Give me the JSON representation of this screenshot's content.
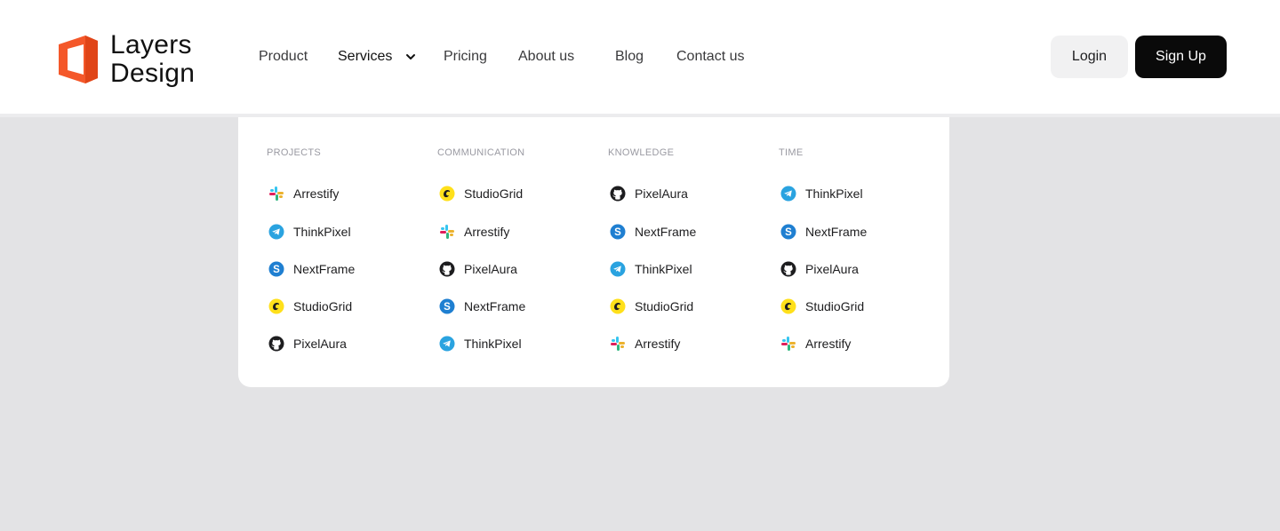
{
  "brand": {
    "line1": "Layers",
    "line2": "Design",
    "color": "#f4582a"
  },
  "nav": {
    "items": [
      {
        "label": "Product"
      },
      {
        "label": "Services"
      },
      {
        "label": "Pricing"
      },
      {
        "label": "About us"
      },
      {
        "label": "Blog"
      },
      {
        "label": "Contact us"
      }
    ],
    "active": "Services"
  },
  "auth": {
    "login_label": "Login",
    "signup_label": "Sign Up"
  },
  "dropdown": {
    "columns": [
      {
        "title": "PROJECTS",
        "items": [
          {
            "label": "Arrestify",
            "icon": "slack-icon"
          },
          {
            "label": "ThinkPixel",
            "icon": "telegram-icon"
          },
          {
            "label": "NextFrame",
            "icon": "skype-icon"
          },
          {
            "label": "StudioGrid",
            "icon": "mailchimp-icon"
          },
          {
            "label": "PixelAura",
            "icon": "github-icon"
          }
        ]
      },
      {
        "title": "COMMUNICATION",
        "items": [
          {
            "label": "StudioGrid",
            "icon": "mailchimp-icon"
          },
          {
            "label": "Arrestify",
            "icon": "slack-icon"
          },
          {
            "label": "PixelAura",
            "icon": "github-icon"
          },
          {
            "label": "NextFrame",
            "icon": "skype-icon"
          },
          {
            "label": "ThinkPixel",
            "icon": "telegram-icon"
          }
        ]
      },
      {
        "title": "KNOWLEDGE",
        "items": [
          {
            "label": "PixelAura",
            "icon": "github-icon"
          },
          {
            "label": "NextFrame",
            "icon": "skype-icon"
          },
          {
            "label": "ThinkPixel",
            "icon": "telegram-icon"
          },
          {
            "label": "StudioGrid",
            "icon": "mailchimp-icon"
          },
          {
            "label": "Arrestify",
            "icon": "slack-icon"
          }
        ]
      },
      {
        "title": "TIME",
        "items": [
          {
            "label": "ThinkPixel",
            "icon": "telegram-icon"
          },
          {
            "label": "NextFrame",
            "icon": "skype-icon"
          },
          {
            "label": "PixelAura",
            "icon": "github-icon"
          },
          {
            "label": "StudioGrid",
            "icon": "mailchimp-icon"
          },
          {
            "label": "Arrestify",
            "icon": "slack-icon"
          }
        ]
      }
    ]
  }
}
